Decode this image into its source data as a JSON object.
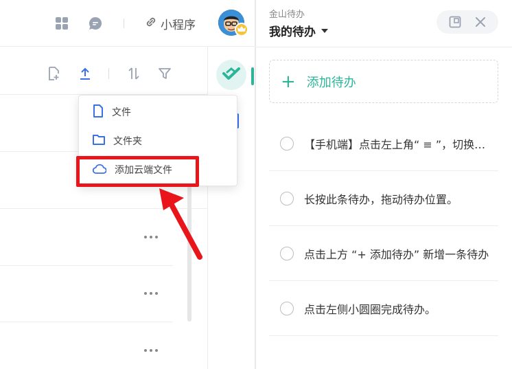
{
  "topbar": {
    "mini_program_label": "小程序"
  },
  "dropdown": {
    "items": [
      {
        "label": "文件",
        "icon": "file-icon"
      },
      {
        "label": "文件夹",
        "icon": "folder-icon"
      },
      {
        "label": "添加云端文件",
        "icon": "cloud-icon"
      }
    ]
  },
  "todo_panel": {
    "app_name": "金山待办",
    "title": "我的待办",
    "add_label": "添加待办",
    "items": [
      "【手机端】点击左上角“ ≡ ”，切换待办清单",
      "长按此条待办，拖动待办位置。",
      "点击上方 “+ 添加待办” 新增一条待办",
      "点击左侧小圆圈完成待办。"
    ]
  },
  "colors": {
    "accent_green": "#2db59a",
    "icon_blue": "#3b6fe8",
    "annotation_red": "#e8161b"
  }
}
